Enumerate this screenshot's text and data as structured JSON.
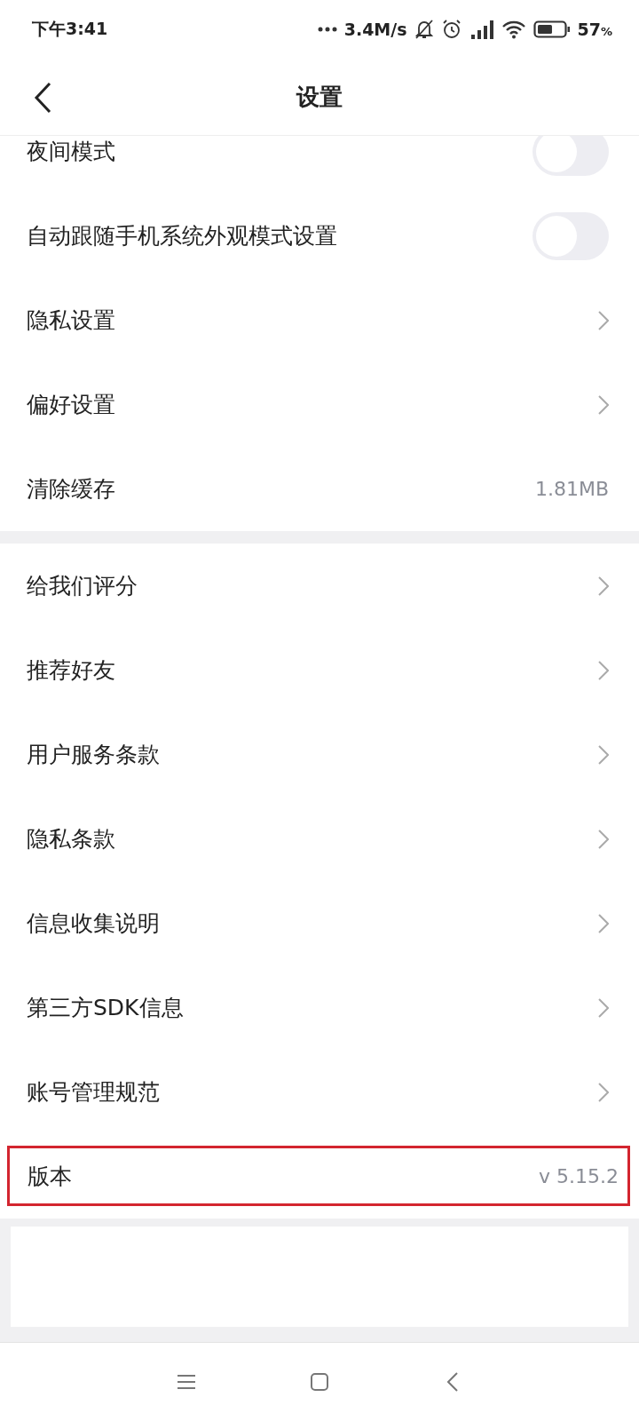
{
  "status_bar": {
    "time": "下午3:41",
    "speed": "3.4M/s",
    "battery_text": "57",
    "battery_unit": "%",
    "battery": {
      "level": 0.57
    }
  },
  "header": {
    "title": "设置"
  },
  "sections": [
    {
      "rows": [
        {
          "kind": "toggle",
          "label": "夜间模式",
          "on": false
        },
        {
          "kind": "toggle",
          "label": "自动跟随手机系统外观模式设置",
          "on": false
        },
        {
          "kind": "link",
          "label": "隐私设置"
        },
        {
          "kind": "link",
          "label": "偏好设置"
        },
        {
          "kind": "value",
          "label": "清除缓存",
          "value": "1.81MB"
        }
      ]
    },
    {
      "rows": [
        {
          "kind": "link",
          "label": "给我们评分"
        },
        {
          "kind": "link",
          "label": "推荐好友"
        },
        {
          "kind": "link",
          "label": "用户服务条款"
        },
        {
          "kind": "link",
          "label": "隐私条款"
        },
        {
          "kind": "link",
          "label": "信息收集说明"
        },
        {
          "kind": "link",
          "label": "第三方SDK信息"
        },
        {
          "kind": "link",
          "label": "账号管理规范"
        },
        {
          "kind": "value",
          "label": "版本",
          "value": "v 5.15.2",
          "highlighted": true
        }
      ]
    }
  ]
}
